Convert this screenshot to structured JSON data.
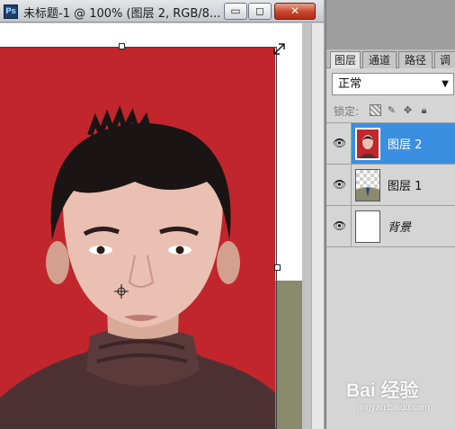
{
  "window": {
    "title": "未标题-1 @ 100% (图层 2, RGB/8...",
    "app_icon_text": "Ps",
    "minimize_glyph": "▭",
    "maximize_glyph": "◻",
    "close_glyph": "✕"
  },
  "layers_panel": {
    "tabs": [
      {
        "label": "图层",
        "active": true
      },
      {
        "label": "通道",
        "active": false
      },
      {
        "label": "路径",
        "active": false
      },
      {
        "label": "调",
        "active": false
      }
    ],
    "blend_mode": "正常",
    "lock_label": "锁定:",
    "layers": [
      {
        "name": "图层 2",
        "selected": true,
        "visible": true,
        "thumbnail": "portrait-red-bg"
      },
      {
        "name": "图层 1",
        "selected": false,
        "visible": true,
        "thumbnail": "transparent-with-figure"
      },
      {
        "name": "背景",
        "selected": false,
        "visible": true,
        "thumbnail": "white"
      }
    ]
  },
  "icons": {
    "eye": "eye-icon",
    "lock_transparent": "lock-transparent-pixels-icon",
    "lock_paint": "brush-icon",
    "lock_move": "move-icon",
    "lock_all": "lock-icon",
    "dropdown": "chevron-down-icon"
  },
  "colors": {
    "photo_background": "#c0262c",
    "selection_highlight": "#3b8fe0",
    "close_button": "#c8442b"
  },
  "watermark": {
    "main": "Bai 经验",
    "sub": "jingyan.baidu.com"
  }
}
